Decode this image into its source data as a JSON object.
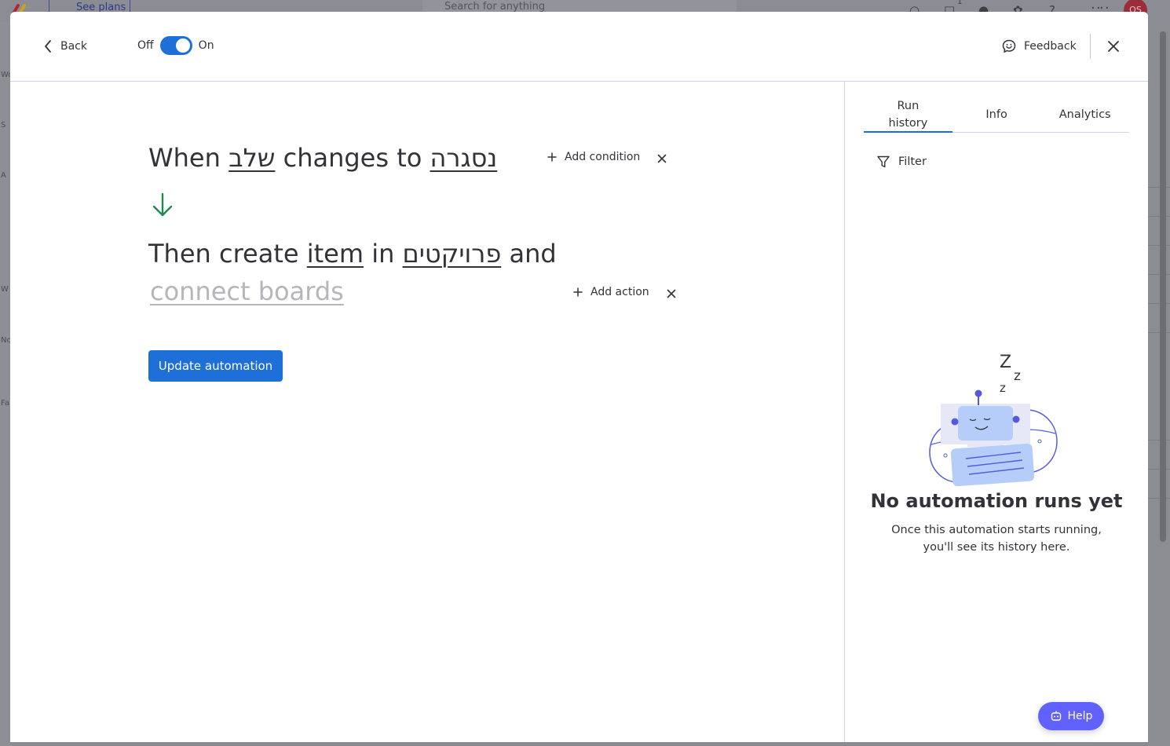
{
  "background": {
    "plans_label": "See plans",
    "search_placeholder": "Search for anything",
    "notification_count": "1",
    "avatar_initials": "OS",
    "side_labels": [
      "Wo",
      "S",
      "A",
      "W",
      "No",
      "Fa"
    ]
  },
  "header": {
    "back_label": "Back",
    "toggle_off_label": "Off",
    "toggle_on_label": "On",
    "toggle_state": "on",
    "feedback_label": "Feedback"
  },
  "recipe": {
    "trigger": {
      "when": "When",
      "column_token": "שלב",
      "changes_to": "changes to",
      "value_token": "נסגרה"
    },
    "action": {
      "then_create": "Then create",
      "item_token": "item",
      "in_word": "in",
      "board_token": "פרויקטים",
      "and_word": "and",
      "connect_token": "connect boards"
    },
    "add_condition_label": "Add condition",
    "add_action_label": "Add action",
    "update_button_label": "Update automation"
  },
  "panel": {
    "tabs": [
      {
        "label": "Run history",
        "active": true
      },
      {
        "label": "Info",
        "active": false
      },
      {
        "label": "Analytics",
        "active": false
      }
    ],
    "filter_label": "Filter",
    "empty_state": {
      "title": "No automation runs yet",
      "description_line1": "Once this automation starts running,",
      "description_line2": "you'll see its history here."
    },
    "help_label": "Help"
  },
  "colors": {
    "primary": "#1f6fd9",
    "arrow_green": "#1f8a4c",
    "help_purple": "#6161ff",
    "text": "#323338"
  }
}
